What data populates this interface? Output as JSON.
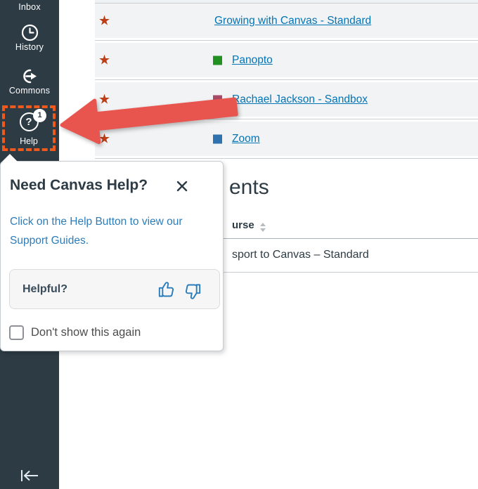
{
  "colors": {
    "nav_bg": "#2D3B45",
    "link": "#0374B5",
    "highlight_orange": "#F0591C",
    "arrow_red": "#E8544E",
    "star": "#BF3E16",
    "panopto_square": "#219122",
    "rachael_square": "#A84A68",
    "zoom_square": "#2E73B0"
  },
  "sidebar": {
    "items": [
      {
        "label": "Inbox"
      },
      {
        "label": "History"
      },
      {
        "label": "Commons"
      },
      {
        "label": "Help",
        "badge": "1",
        "icon_glyph": "?"
      }
    ]
  },
  "icons": {
    "star_glyph": "★"
  },
  "course_rows": [
    {
      "label": "Growing with Canvas - Standard",
      "color": null
    },
    {
      "label": "Panopto",
      "color": "#219122"
    },
    {
      "label": "Rachael Jackson - Sandbox",
      "color": "#A84A68"
    },
    {
      "label": "Zoom",
      "color": "#2E73B0"
    }
  ],
  "enrollments": {
    "heading_fragment": "ents",
    "column_fragment": "urse",
    "row_fragment": "sport to Canvas – Standard"
  },
  "popup": {
    "title": "Need Canvas Help?",
    "body": "Click on the Help Button to view our Support Guides.",
    "helpful_label": "Helpful?",
    "checkbox_label": "Don't show this again"
  }
}
